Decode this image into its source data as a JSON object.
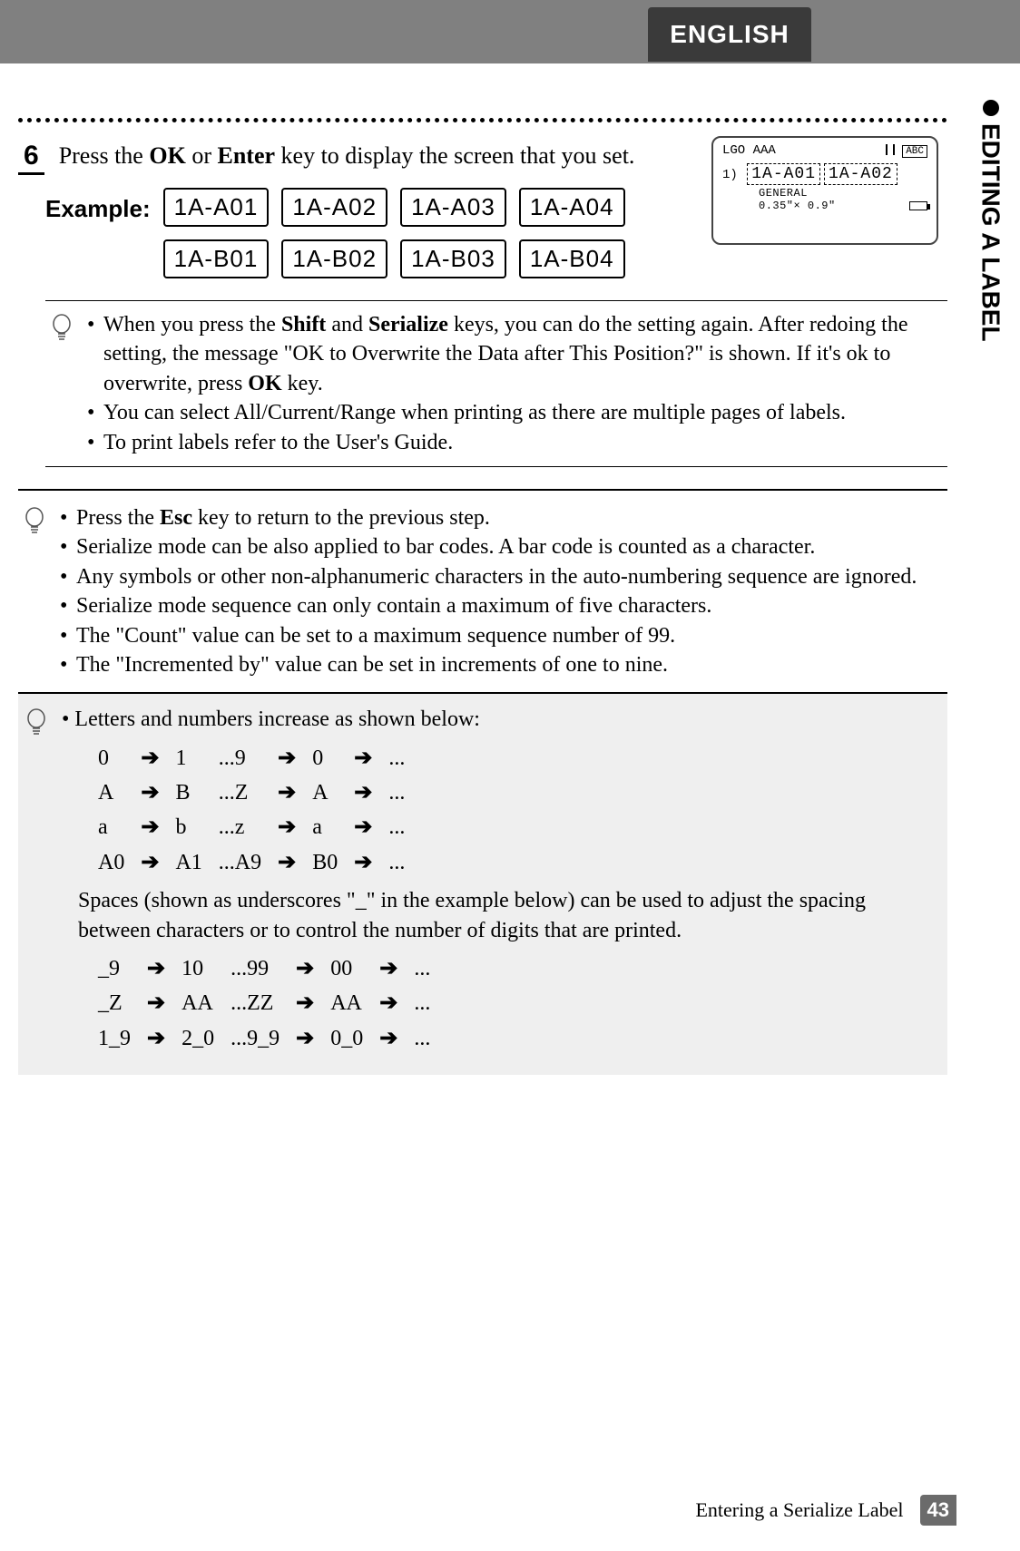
{
  "header": {
    "language": "ENGLISH"
  },
  "side_tab": {
    "title": "EDITING A LABEL"
  },
  "step": {
    "num": "6",
    "text_pre": "Press the ",
    "bold1": "OK",
    "text_mid": " or ",
    "bold2": "Enter",
    "text_post": " key to display the screen that you set."
  },
  "example": {
    "label": "Example:",
    "labels": [
      "1A-A01",
      "1A-A02",
      "1A-A03",
      "1A-A04",
      "1A-B01",
      "1A-B02",
      "1A-B03",
      "1A-B04"
    ]
  },
  "screen": {
    "line1_left": "LGO AAA",
    "line1_right": "ABC",
    "idx": "1)",
    "sel1": "1A-A01",
    "sel2": "1A-A02",
    "line3a": "GENERAL",
    "line3b": "0.35\"× 0.9\""
  },
  "note1": {
    "items": [
      "When you press the <b>Shift</b> and <b>Serialize</b> keys, you can do the setting again. After redoing the setting, the message \"OK to Overwrite the Data after This Position?\" is shown. If it's ok to overwrite, press <b>OK</b> key.",
      "You can select All/Current/Range when printing as there are multiple pages of labels.",
      "To print labels refer to the User's Guide."
    ]
  },
  "note2": {
    "items": [
      "Press the <b>Esc</b> key to return to the previous step.",
      "Serialize mode can be also applied to bar codes. A bar code is counted as a character.",
      "Any symbols or other non-alphanumeric characters in the auto-numbering sequence are ignored.",
      "Serialize mode sequence can only contain a maximum of five characters.",
      "The \"Count\" value can be set to a maximum sequence number of 99.",
      "The \"Incremented by\" value can be set in increments of one to nine."
    ]
  },
  "increment": {
    "intro": "Letters and numbers increase as shown below:",
    "rows1": [
      [
        "0",
        "1",
        "...9",
        "0",
        "..."
      ],
      [
        "A",
        "B",
        "...Z",
        "A",
        "..."
      ],
      [
        "a",
        "b",
        "...z",
        "a",
        "..."
      ],
      [
        "A0",
        "A1",
        "...A9",
        "B0",
        "..."
      ]
    ],
    "spaces_text": "Spaces (shown as underscores \"_\" in the example below) can be used to adjust the spacing between characters or to control the number of digits that are printed.",
    "rows2": [
      [
        "_9",
        "10",
        "...99",
        "00",
        "..."
      ],
      [
        "_Z",
        "AA",
        "...ZZ",
        "AA",
        "..."
      ],
      [
        "1_9",
        "2_0",
        "...9_9",
        "0_0",
        "..."
      ]
    ]
  },
  "footer": {
    "title": "Entering a Serialize Label",
    "page": "43"
  }
}
